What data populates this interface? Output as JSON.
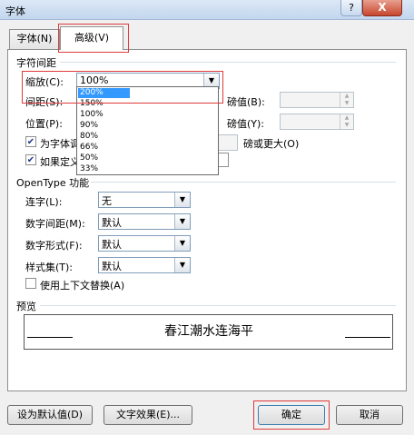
{
  "window": {
    "title": "字体",
    "help": "?",
    "close": "X"
  },
  "tabs": [
    {
      "label": "字体(N)"
    },
    {
      "label": "高级(V)"
    }
  ],
  "spacing": {
    "section": "字符间距",
    "scale_label": "缩放(C):",
    "scale_value": "100%",
    "scale_options": [
      "200%",
      "150%",
      "100%",
      "90%",
      "80%",
      "66%",
      "50%",
      "33%"
    ],
    "spacing_label": "间距(S):",
    "position_label": "位置(P):",
    "pound_b_label": "磅值(B):",
    "pound_y_label": "磅值(Y):",
    "kerning_label": "为字体调",
    "kerning_suffix": "磅或更大(O)",
    "grid_label": "如果定义"
  },
  "opentype": {
    "section": "OpenType 功能",
    "ligatures_label": "连字(L):",
    "ligatures_value": "无",
    "num_spacing_label": "数字间距(M):",
    "num_spacing_value": "默认",
    "num_form_label": "数字形式(F):",
    "num_form_value": "默认",
    "style_set_label": "样式集(T):",
    "style_set_value": "默认",
    "contextual_label": "使用上下文替换(A)"
  },
  "preview": {
    "section": "预览",
    "sample": "春江潮水连海平"
  },
  "buttons": {
    "set_default": "设为默认值(D)",
    "text_effects": "文字效果(E)...",
    "ok": "确定",
    "cancel": "取消"
  }
}
